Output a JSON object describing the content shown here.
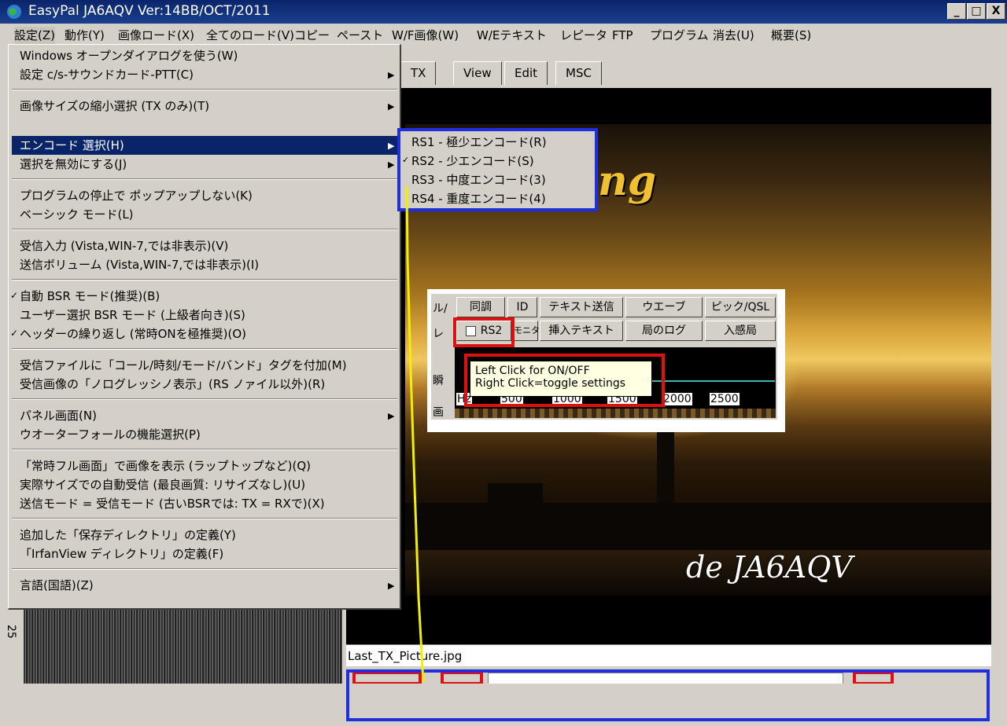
{
  "window": {
    "title": "EasyPal  JA6AQV  Ver:14BB/OCT/2011",
    "min": "_",
    "max": "□",
    "close": "X"
  },
  "menubar": [
    "設定(Z)",
    "動作(Y)",
    "画像ロード(X)",
    "全てのロード(V)",
    "コピー",
    "ペースト",
    "W/F画像(W)",
    "W/Eテキスト",
    "レピータ",
    "FTP",
    "プログラム",
    "消去(U)",
    "概要(S)"
  ],
  "tabs": [
    "TX",
    "View",
    "Edit",
    "MSC"
  ],
  "dropdown": {
    "items": [
      "Windows オープンダイアログを使う(W)",
      "設定 c/s-サウンドカード-PTT(C)",
      "画像サイズの縮小選択 (TX のみ)(T)",
      "エンコード  選択(H)",
      "選択を無効にする(J)",
      "プログラムの停止で ポップアップしない(K)",
      "ベーシック  モード(L)",
      "受信入力    (Vista,WIN-7,では非表示)(V)",
      "送信ボリューム  (Vista,WIN-7,では非表示)(I)",
      "自動 BSR モード(推奨)(B)",
      "ユーザー選択  BSR モード (上級者向き)(S)",
      "ヘッダーの繰り返し (常時ONを極推奨)(O)",
      "受信ファイルに「コール/時刻/モード/バンド」タグを付加(M)",
      "受信画像の「ノログレッシノ表示」(RS ノァイル以外)(R)",
      "パネル画面(N)",
      "ウオーターフォールの機能選択(P)",
      "「常時フル画面」で画像を表示 (ラップトップなど)(Q)",
      "実際サイズでの自動受信 (最良画質: リサイズなし)(U)",
      "送信モード = 受信モード (古いBSRでは: TX = RXで)(X)",
      "追加した「保存ディレクトリ」の定義(Y)",
      "「IrfanView ディレクトリ」の定義(F)",
      "言語(国語)(Z)"
    ],
    "check_mark": "✓",
    "arrow": "▶"
  },
  "submenu": {
    "items": [
      "RS1 - 極少エンコード(R)",
      "RS2 - 少エンコード(S)",
      "RS3 - 中度エンコード(3)",
      "RS4 - 重度エンコード(4)"
    ]
  },
  "inset": {
    "row1": [
      "同調",
      "ID",
      "テキスト送信",
      "ウエーブ",
      "ピック/QSL"
    ],
    "row2": [
      "RS2",
      "モニタ",
      "挿入テキスト",
      "局のログ",
      "入感局"
    ],
    "left_labels": [
      "ル/",
      "レ",
      "瞬",
      "画"
    ],
    "ticks": [
      "500",
      "1000",
      "1500",
      "2000",
      "2500"
    ],
    "hz": "Hz",
    "tooltip_line1": "Left Click for ON/OFF",
    "tooltip_line2": "Right Click=toggle settings"
  },
  "picture": {
    "filename": "Last_TX_Picture.jpg",
    "callsign": "de JA6AQV",
    "partial_text": "ng"
  },
  "ruler": {
    "label": "25"
  },
  "colors": {
    "highlight": "#0a246a",
    "annotation_red": "#e01010",
    "annotation_blue": "#1f2fe0",
    "annotation_yellow": "#f0f000"
  }
}
